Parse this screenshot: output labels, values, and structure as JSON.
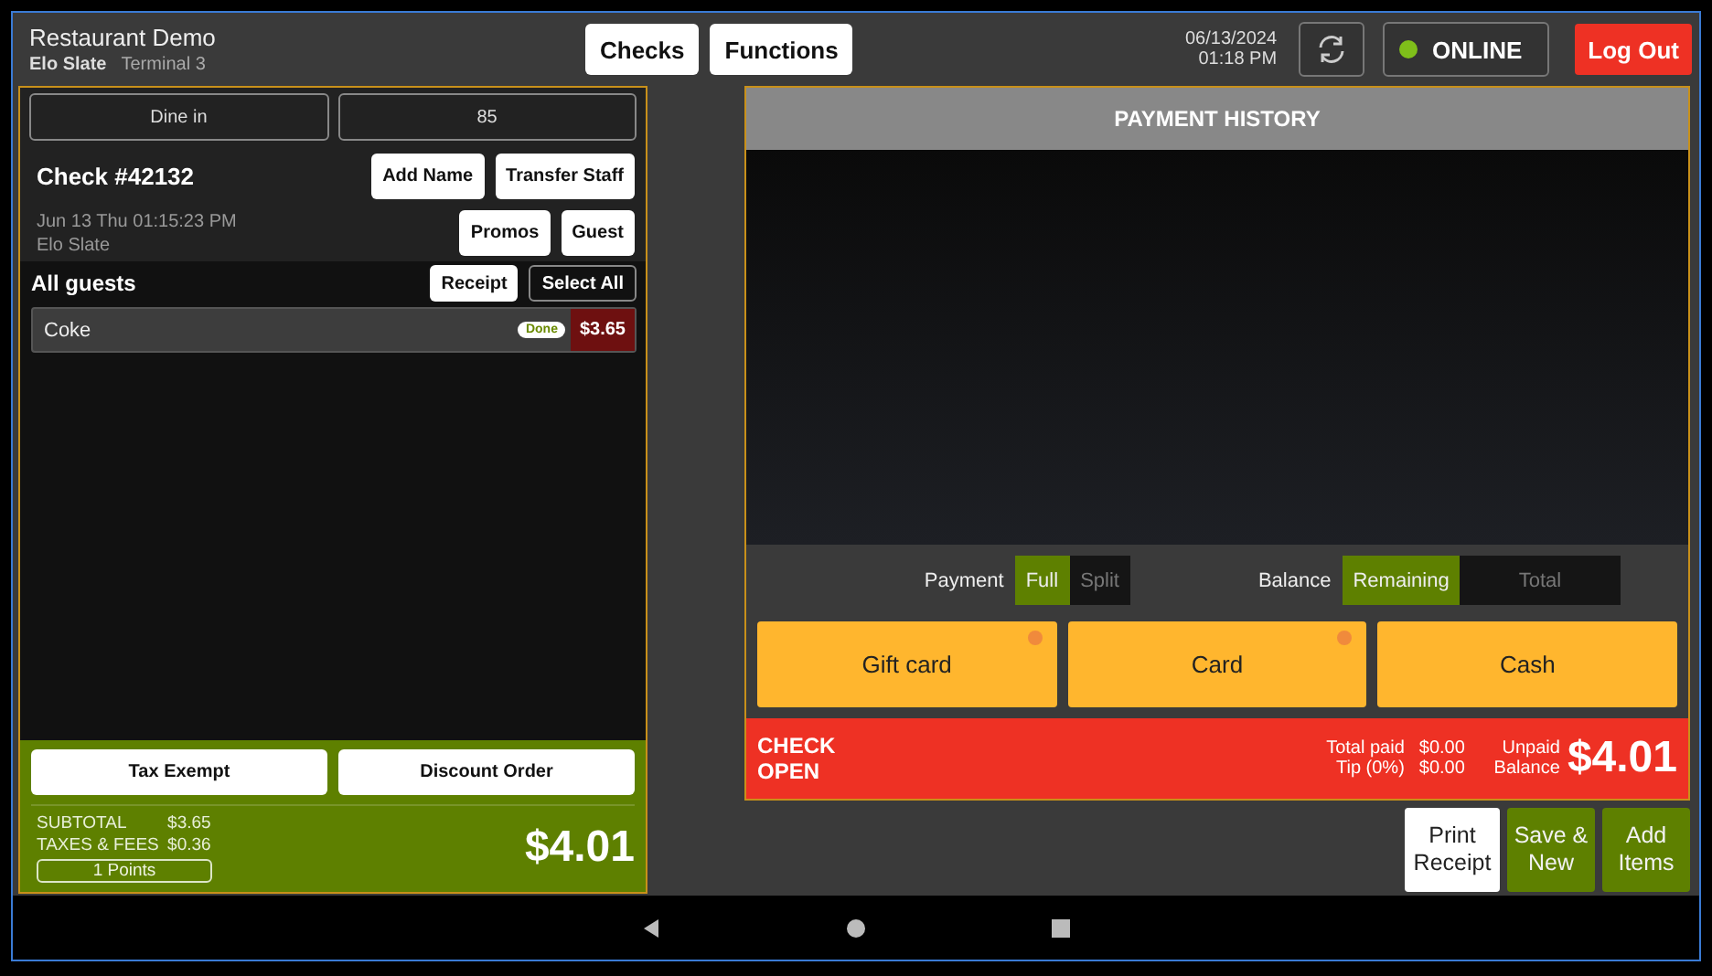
{
  "header": {
    "restaurant": "Restaurant Demo",
    "device": "Elo Slate",
    "terminal": "Terminal 3",
    "nav_buttons": [
      "Checks",
      "Functions"
    ],
    "date": "06/13/2024",
    "time": "01:18 PM",
    "status": {
      "label": "ONLINE",
      "online": true
    },
    "logout": "Log Out"
  },
  "order": {
    "fields": [
      "Dine in",
      "85"
    ],
    "check_title": "Check #42132",
    "timestamp": "Jun 13 Thu 01:15:23 PM",
    "staff": "Elo Slate",
    "buttons_row1": [
      "Add Name",
      "Transfer Staff"
    ],
    "buttons_row2": [
      "Promos",
      "Guest"
    ],
    "guests": {
      "title": "All guests",
      "buttons": [
        {
          "label": "Receipt",
          "kind": "light"
        },
        {
          "label": "Select All",
          "kind": "dark"
        }
      ]
    },
    "items": [
      {
        "name": "Coke",
        "status": "Done",
        "price": "$3.65"
      }
    ],
    "actions": [
      "Tax Exempt",
      "Discount Order"
    ],
    "totals": [
      {
        "label": "SUBTOTAL",
        "value": "$3.65"
      },
      {
        "label": "TAXES & FEES",
        "value": "$0.36"
      }
    ],
    "points": "1  Points",
    "total": "$4.01"
  },
  "payment": {
    "title": "PAYMENT HISTORY",
    "toggles": [
      {
        "label": "Payment",
        "options": [
          {
            "label": "Full",
            "selected": true
          },
          {
            "label": "Split",
            "selected": false
          }
        ]
      },
      {
        "label": "Balance",
        "options": [
          {
            "label": "Remaining",
            "selected": true
          },
          {
            "label": "Total",
            "selected": false
          }
        ]
      }
    ],
    "methods": [
      {
        "label": "Gift card",
        "indicator": true
      },
      {
        "label": "Card",
        "indicator": true
      },
      {
        "label": "Cash",
        "indicator": false
      }
    ],
    "status": "CHECK OPEN",
    "summary": [
      {
        "label": "Total paid",
        "value": "$0.00"
      },
      {
        "label": "Tip (0%)",
        "value": "$0.00"
      }
    ],
    "unpaid_label": "Unpaid Balance",
    "unpaid": "$4.01"
  },
  "bottom_buttons": [
    {
      "label": "Print Receipt",
      "kind": "light"
    },
    {
      "label": "Save & New",
      "kind": "green"
    },
    {
      "label": "Add Items",
      "kind": "green"
    }
  ]
}
